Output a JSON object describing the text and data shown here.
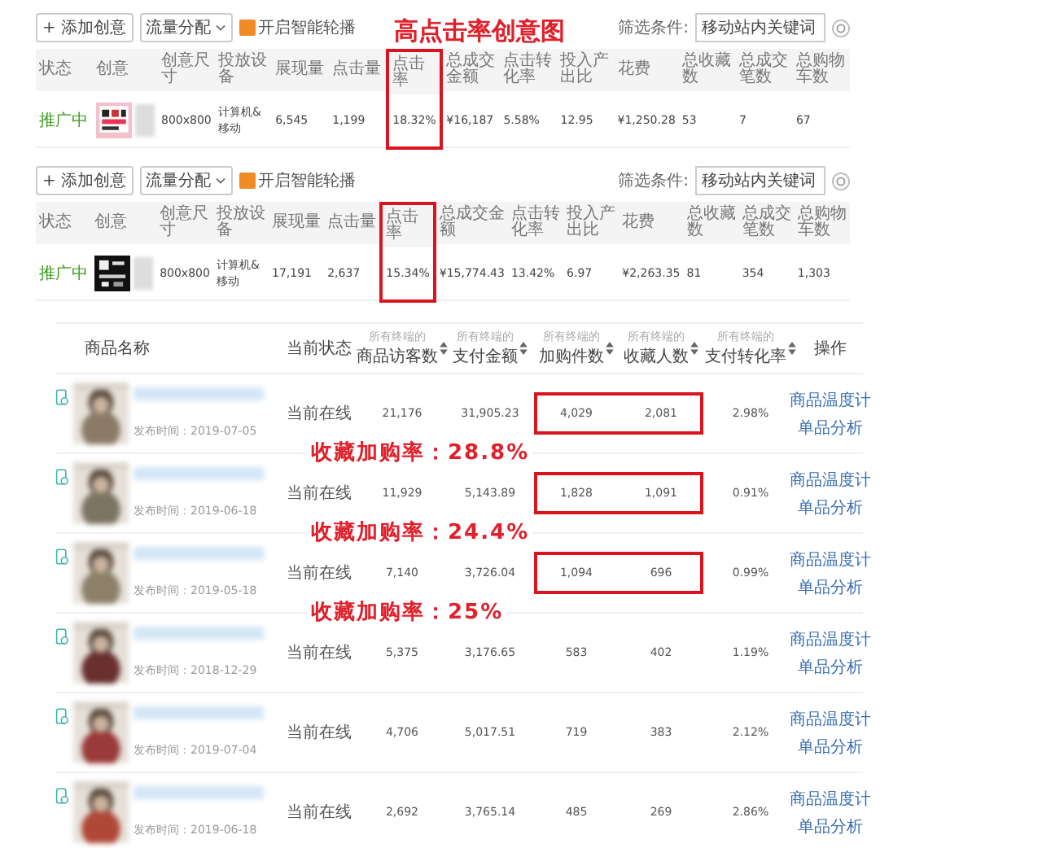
{
  "headline": "高点击率创意图",
  "creative_panels": [
    {
      "toolbar": {
        "add_button": "+ 添加创意",
        "traffic_dropdown": "流量分配",
        "smart_rotation": {
          "label": "开启智能轮播",
          "checked": true
        },
        "filter_label": "筛选条件:",
        "filter_select": "移动站内关键词"
      },
      "columns": [
        {
          "label": "状态",
          "highlighted": false
        },
        {
          "label": "创意",
          "highlighted": false
        },
        {
          "label": "创意尺寸",
          "highlighted": false
        },
        {
          "label": "投放设备",
          "highlighted": false
        },
        {
          "label": "展现量",
          "highlighted": false
        },
        {
          "label": "点击量",
          "highlighted": false
        },
        {
          "label": "点击率",
          "highlighted": true
        },
        {
          "label": "总成交金额",
          "highlighted": false
        },
        {
          "label": "点击转化率",
          "highlighted": false
        },
        {
          "label": "投入产出比",
          "highlighted": false
        },
        {
          "label": "花费",
          "highlighted": false
        },
        {
          "label": "总收藏数",
          "highlighted": false
        },
        {
          "label": "总成交笔数",
          "highlighted": false
        },
        {
          "label": "总购物车数",
          "highlighted": false
        }
      ],
      "row": {
        "status": "推广中",
        "cells": [
          "800x800",
          "计算机&移动",
          "6,545",
          "1,199",
          "18.32%",
          "¥16,187",
          "5.58%",
          "12.95",
          "¥1,250.28",
          "53",
          "7",
          "67"
        ]
      }
    },
    {
      "toolbar": {
        "add_button": "+ 添加创意",
        "traffic_dropdown": "流量分配",
        "smart_rotation": {
          "label": "开启智能轮播",
          "checked": true
        },
        "filter_label": "筛选条件:",
        "filter_select": "移动站内关键词"
      },
      "columns": [
        {
          "label": "状态",
          "highlighted": false
        },
        {
          "label": "创意",
          "highlighted": false
        },
        {
          "label": "创意尺寸",
          "highlighted": false
        },
        {
          "label": "投放设备",
          "highlighted": false
        },
        {
          "label": "展现量",
          "highlighted": false
        },
        {
          "label": "点击量",
          "highlighted": false
        },
        {
          "label": "点击率",
          "highlighted": true
        },
        {
          "label": "总成交金额",
          "highlighted": false
        },
        {
          "label": "点击转化率",
          "highlighted": false
        },
        {
          "label": "投入产出比",
          "highlighted": false
        },
        {
          "label": "花费",
          "highlighted": false
        },
        {
          "label": "总收藏数",
          "highlighted": false
        },
        {
          "label": "总成交笔数",
          "highlighted": false
        },
        {
          "label": "总购物车数",
          "highlighted": false
        }
      ],
      "row": {
        "status": "推广中",
        "cells": [
          "800x800",
          "计算机&移动",
          "17,191",
          "2,637",
          "15.34%",
          "¥15,774.43",
          "13.42%",
          "6.97",
          "¥2,263.35",
          "81",
          "354",
          "1,303"
        ]
      }
    }
  ],
  "product_table": {
    "columns": [
      {
        "label": "商品名称"
      },
      {
        "label": "当前状态"
      },
      {
        "prefix": "所有终端的",
        "label": "商品访客数",
        "sortable": true
      },
      {
        "prefix": "所有终端的",
        "label": "支付金额",
        "sortable": true
      },
      {
        "prefix": "所有终端的",
        "label": "加购件数",
        "sortable": true
      },
      {
        "prefix": "所有终端的",
        "label": "收藏人数",
        "sortable": true
      },
      {
        "prefix": "所有终端的",
        "label": "支付转化率",
        "sortable": true
      },
      {
        "label": "操作"
      }
    ],
    "rows": [
      {
        "published": "发布时间：2019-07-05",
        "status": "当前在线",
        "visitors": "21,176",
        "payment": "31,905.23",
        "cart": "4,029",
        "favorites": "2,081",
        "conversion": "2.98%",
        "actions": [
          "商品温度计",
          "单品分析"
        ],
        "highlighted": true,
        "note": "收藏加购率：28.8%"
      },
      {
        "published": "发布时间：2019-06-18",
        "status": "当前在线",
        "visitors": "11,929",
        "payment": "5,143.89",
        "cart": "1,828",
        "favorites": "1,091",
        "conversion": "0.91%",
        "actions": [
          "商品温度计",
          "单品分析"
        ],
        "highlighted": true,
        "note": "收藏加购率：24.4%"
      },
      {
        "published": "发布时间：2019-05-18",
        "status": "当前在线",
        "visitors": "7,140",
        "payment": "3,726.04",
        "cart": "1,094",
        "favorites": "696",
        "conversion": "0.99%",
        "actions": [
          "商品温度计",
          "单品分析"
        ],
        "highlighted": true,
        "note": "收藏加购率：25%"
      },
      {
        "published": "发布时间：2018-12-29",
        "status": "当前在线",
        "visitors": "5,375",
        "payment": "3,176.65",
        "cart": "583",
        "favorites": "402",
        "conversion": "1.19%",
        "actions": [
          "商品温度计",
          "单品分析"
        ],
        "highlighted": false
      },
      {
        "published": "发布时间：2019-07-04",
        "status": "当前在线",
        "visitors": "4,706",
        "payment": "5,017.51",
        "cart": "719",
        "favorites": "383",
        "conversion": "2.12%",
        "actions": [
          "商品温度计",
          "单品分析"
        ],
        "highlighted": false
      },
      {
        "published": "发布时间：2019-06-18",
        "status": "当前在线",
        "visitors": "2,692",
        "payment": "3,765.14",
        "cart": "485",
        "favorites": "269",
        "conversion": "2.86%",
        "actions": [
          "商品温度计",
          "单品分析"
        ],
        "highlighted": false
      }
    ]
  }
}
